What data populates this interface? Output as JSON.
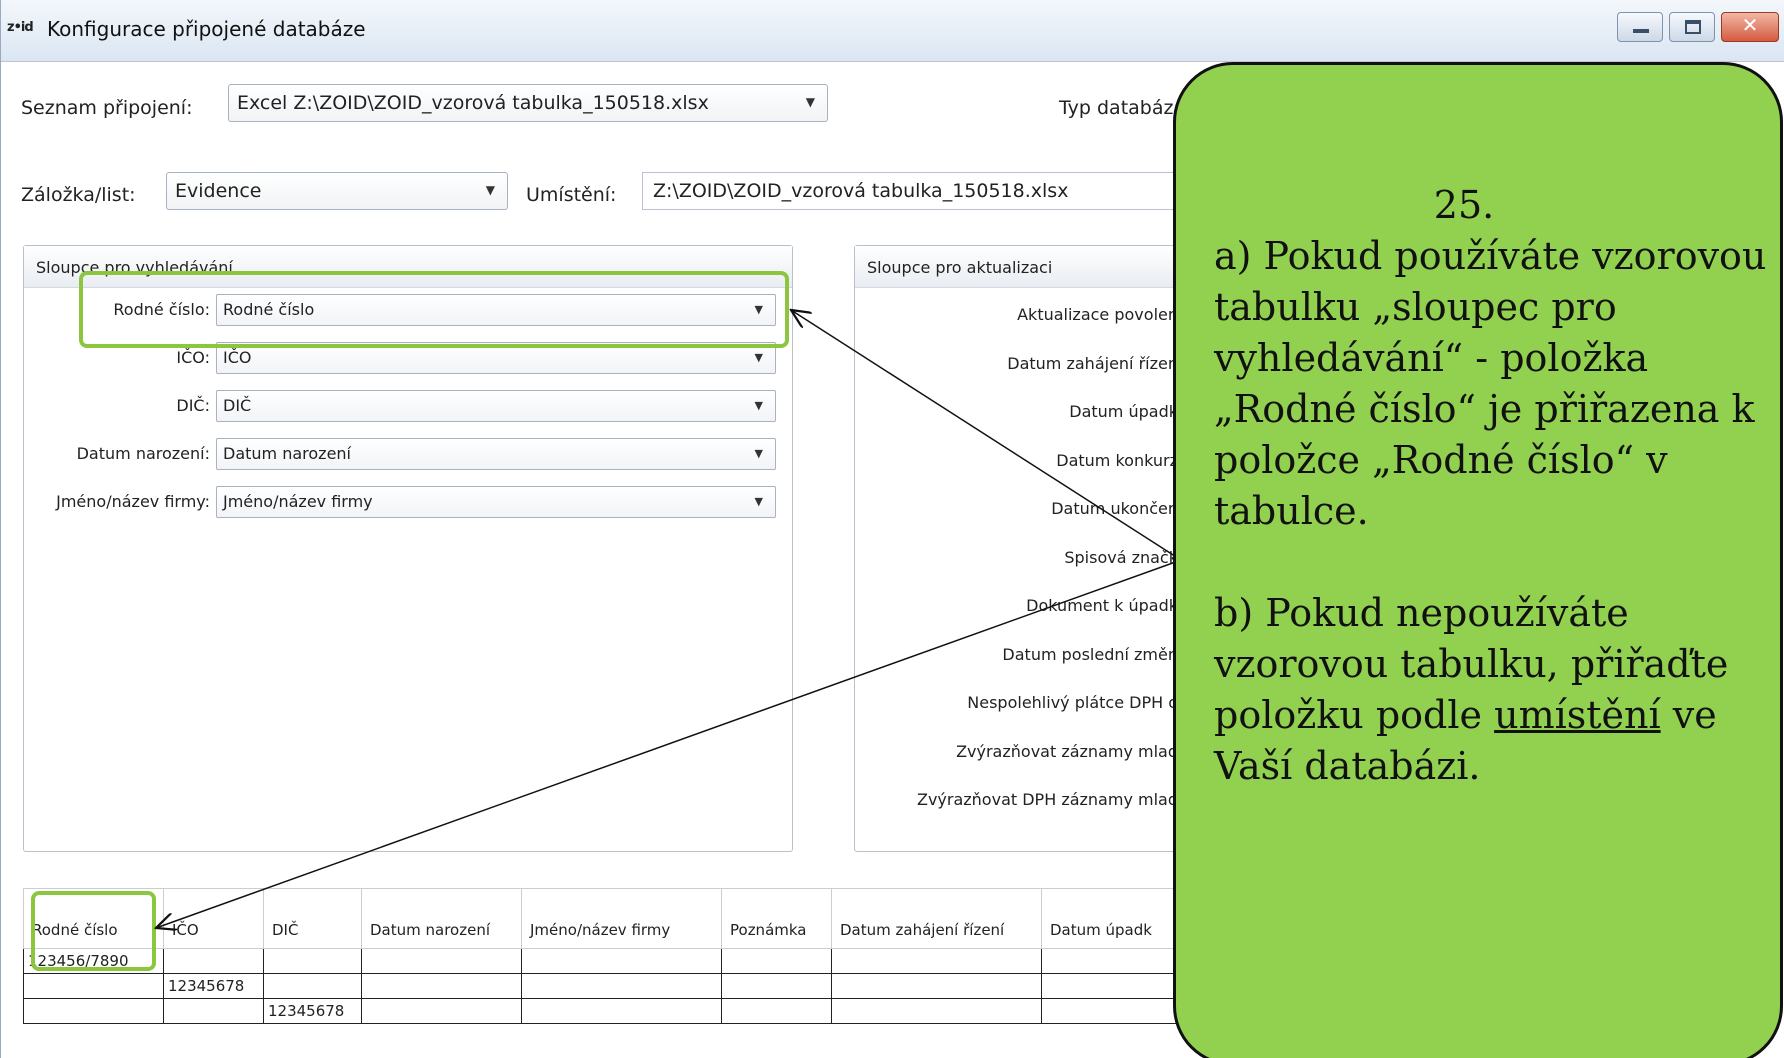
{
  "window": {
    "app_icon": "z•id",
    "title": "Konfigurace připojené databáze"
  },
  "top": {
    "connections_label": "Seznam připojení:",
    "connections_value": "Excel Z:\\ZOID\\ZOID_vzorová tabulka_150518.xlsx",
    "dbtype_label": "Typ databáz",
    "sheet_label": "Záložka/list:",
    "sheet_value": "Evidence",
    "location_label": "Umístění:",
    "location_value": "Z:\\ZOID\\ZOID_vzorová tabulka_150518.xlsx"
  },
  "search_group": {
    "title": "Sloupce pro vyhledávání",
    "fields": [
      {
        "label": "Rodné číslo:",
        "value": "Rodné číslo"
      },
      {
        "label": "IČO:",
        "value": "IČO"
      },
      {
        "label": "DIČ:",
        "value": "DIČ"
      },
      {
        "label": "Datum narození:",
        "value": "Datum narození"
      },
      {
        "label": "Jméno/název firmy:",
        "value": "Jméno/název firmy"
      }
    ]
  },
  "update_group": {
    "title": "Sloupce pro aktualizaci",
    "fields": [
      "Aktualizace povolen",
      "Datum zahájení řízen",
      "Datum úpadk",
      "Datum konkurz",
      "Datum ukončen",
      "Spisová značk",
      "Dokument k úpadk",
      "Datum poslední změn",
      "Nespolehlivý plátce DPH o",
      "Zvýrazňovat záznamy mlad",
      "Zvýrazňovat DPH záznamy mlad"
    ]
  },
  "grid": {
    "columns": [
      "Rodné číslo",
      "IČO",
      "DIČ",
      "Datum narození",
      "Jméno/název firmy",
      "Poznámka",
      "Datum zahájení řízení",
      "Datum úpadk"
    ],
    "rows": [
      [
        "123456/7890",
        "",
        "",
        "",
        "",
        "",
        "",
        ""
      ],
      [
        "",
        "12345678",
        "",
        "",
        "",
        "",
        "",
        ""
      ],
      [
        "",
        "",
        "12345678",
        "",
        "",
        "",
        "",
        ""
      ]
    ]
  },
  "callout": {
    "number": "25.",
    "part_a": "a) Pokud používáte vzorovou tabulku „sloupec pro vyhledávání“ - položka „Rodné číslo“ je přiřazena k položce „Rodné číslo“ v tabulce.",
    "part_b_start": "b) Pokud nepoužíváte vzorovou tabulku, přiřaďte položku podle ",
    "part_b_underlined": "umístění",
    "part_b_end": " ve Vaší databázi."
  },
  "colors": {
    "callout_fill": "#92d050",
    "highlight": "#8cc63f"
  }
}
